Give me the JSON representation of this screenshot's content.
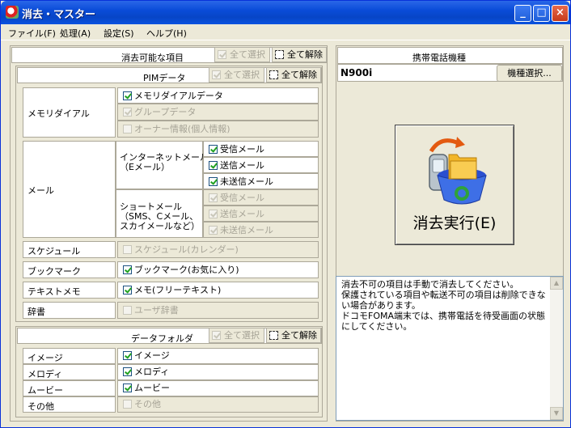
{
  "window": {
    "title": "消去・マスター"
  },
  "menu": [
    "ファイル(F)",
    "処理(A)",
    "設定(S)",
    "ヘルプ(H)"
  ],
  "erasable": {
    "header": "消去可能な項目",
    "select_all": "全て選択",
    "clear_all": "全て解除"
  },
  "pim": {
    "header": "PIMデータ",
    "select_all": "全て選択",
    "clear_all": "全て解除",
    "memory_dial": {
      "label": "メモリダイアル",
      "items": [
        {
          "label": "メモリダイアルデータ",
          "checked": true,
          "disabled": false
        },
        {
          "label": "グループデータ",
          "checked": true,
          "disabled": true
        },
        {
          "label": "オーナー情報(個人情報)",
          "checked": false,
          "disabled": true
        }
      ]
    },
    "mail": {
      "label": "メール",
      "internet_label": "インターネットメール\n（Eメール）",
      "internet_items": [
        {
          "label": "受信メール",
          "checked": true,
          "disabled": false
        },
        {
          "label": "送信メール",
          "checked": true,
          "disabled": false
        },
        {
          "label": "未送信メール",
          "checked": true,
          "disabled": false
        }
      ],
      "short_label": "ショートメール\n（SMS、Cメール、\nスカイメールなど）",
      "short_items": [
        {
          "label": "受信メール",
          "checked": true,
          "disabled": true
        },
        {
          "label": "送信メール",
          "checked": true,
          "disabled": true
        },
        {
          "label": "未送信メール",
          "checked": true,
          "disabled": true
        }
      ]
    },
    "schedule": {
      "label": "スケジュール",
      "item": "スケジュール(カレンダー)",
      "checked": false,
      "disabled": true
    },
    "bookmark": {
      "label": "ブックマーク",
      "item": "ブックマーク(お気に入り)",
      "checked": true,
      "disabled": false
    },
    "textmemo": {
      "label": "テキストメモ",
      "item": "メモ(フリーテキスト)",
      "checked": true,
      "disabled": false
    },
    "dictionary": {
      "label": "辞書",
      "item": "ユーザ辞書",
      "checked": false,
      "disabled": true
    }
  },
  "folder": {
    "header": "データフォルダ",
    "select_all": "全て選択",
    "clear_all": "全て解除",
    "rows": [
      {
        "label": "イメージ",
        "item": "イメージ",
        "checked": true,
        "disabled": false
      },
      {
        "label": "メロディ",
        "item": "メロディ",
        "checked": true,
        "disabled": false
      },
      {
        "label": "ムービー",
        "item": "ムービー",
        "checked": true,
        "disabled": false
      },
      {
        "label": "その他",
        "item": "その他",
        "checked": false,
        "disabled": true
      }
    ]
  },
  "phone": {
    "header": "携帯電話機種",
    "model": "N900i",
    "select_button": "機種選択..."
  },
  "execute_button": "消去実行(E)",
  "info_text": "消去不可の項目は手動で消去してください。\n保護されている項目や転送不可の項目は削除できない場合があります。\nドコモFOMA端末では、携帯電話を待受画面の状態にしてください。",
  "colors": {
    "titlebar": "#0a4cd8",
    "face": "#ece9d8",
    "check": "#21a121"
  }
}
